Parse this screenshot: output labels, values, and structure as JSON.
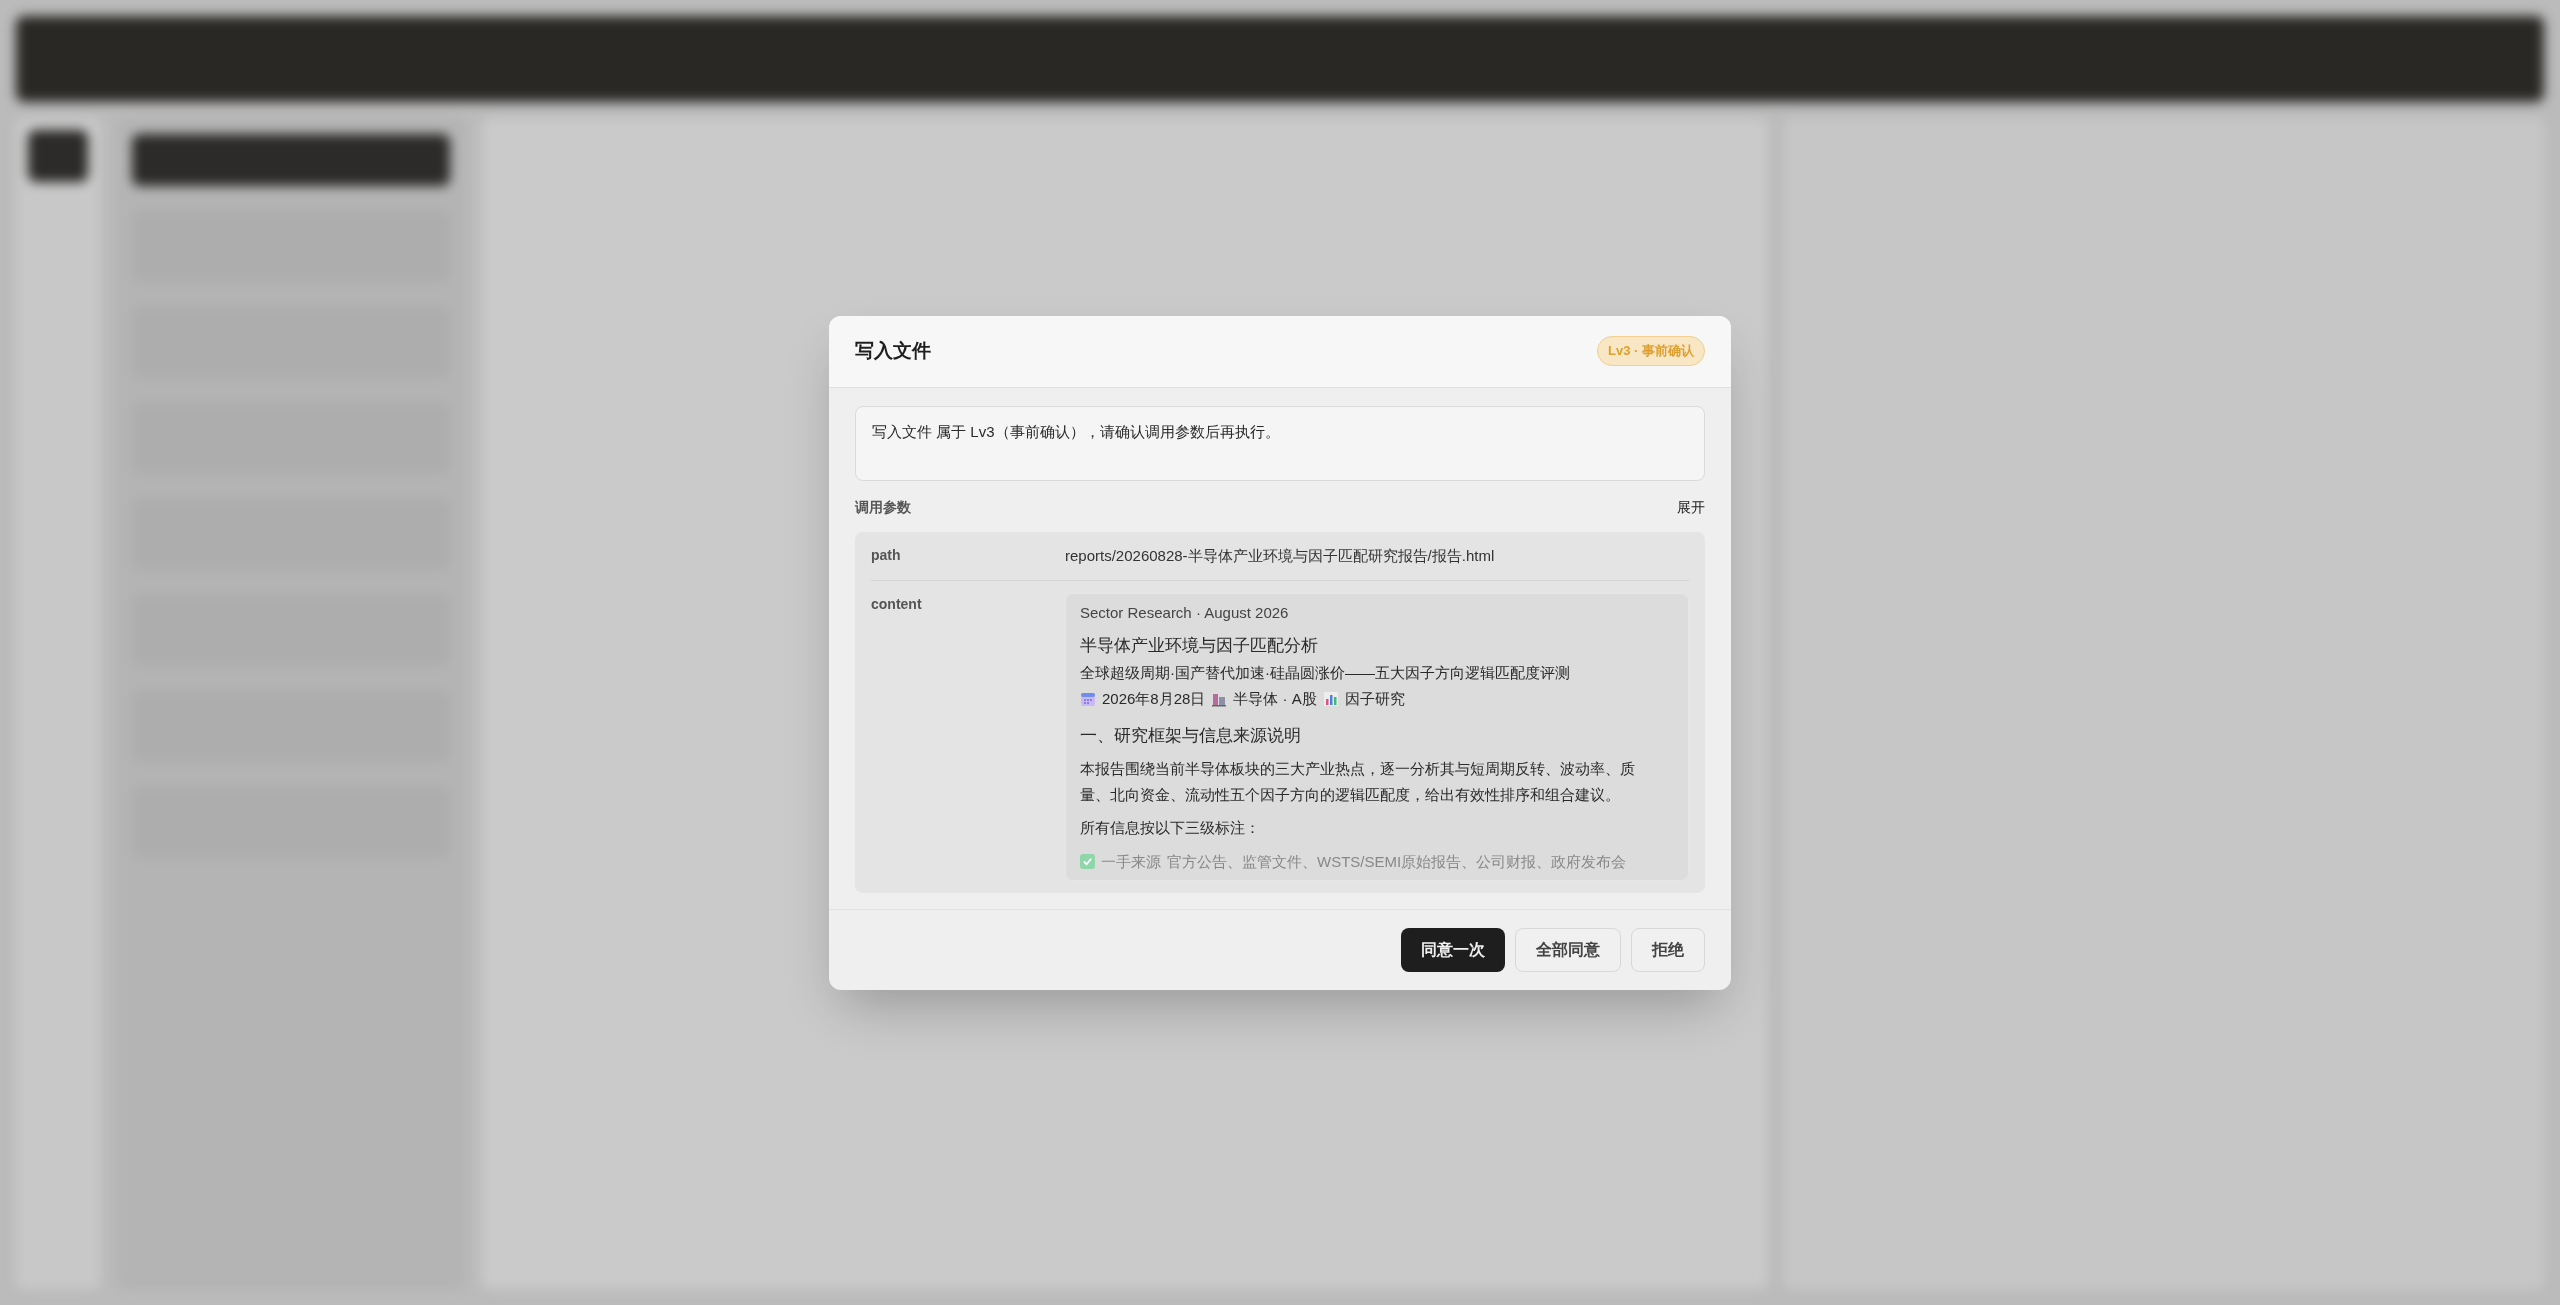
{
  "dialog": {
    "title": "写入文件",
    "badge": "Lv3 · 事前确认",
    "notice": "写入文件 属于 Lv3（事前确认），请确认调用参数后再执行。",
    "params_label": "调用参数",
    "expand_label": "展开",
    "params": [
      {
        "key": "path",
        "kind": "text",
        "value": "reports/20260828-半导体产业环境与因子匹配研究报告/报告.html"
      },
      {
        "key": "content",
        "kind": "document",
        "document": {
          "kicker": "Sector Research · August 2026",
          "title": "半导体产业环境与因子匹配分析",
          "subtitle": "全球超级周期·国产替代加速·硅晶圆涨价——五大因子方向逻辑匹配度评测",
          "meta": [
            {
              "kind": "calendar",
              "text": "2026年8月28日"
            },
            {
              "kind": "building",
              "text": "半导体 · A股"
            },
            {
              "kind": "chart",
              "text": "因子研究"
            }
          ],
          "heading": "一、研究框架与信息来源说明",
          "paragraph": "本报告围绕当前半导体板块的三大产业热点，逐一分析其与短周期反转、波动率、质量、北向资金、流动性五个因子方向的逻辑匹配度，给出有效性排序和组合建议。",
          "note": "所有信息按以下三级标注：",
          "items": [
            {
              "checked": true,
              "label": "一手来源",
              "text": "官方公告、监管文件、WSTS/SEMI原始报告、公司财报、政府发布会"
            }
          ]
        }
      }
    ],
    "buttons": [
      {
        "label": "同意一次",
        "kind": "primary"
      },
      {
        "label": "全部同意",
        "kind": "secondary"
      },
      {
        "label": "拒绝",
        "kind": "secondary"
      }
    ]
  }
}
